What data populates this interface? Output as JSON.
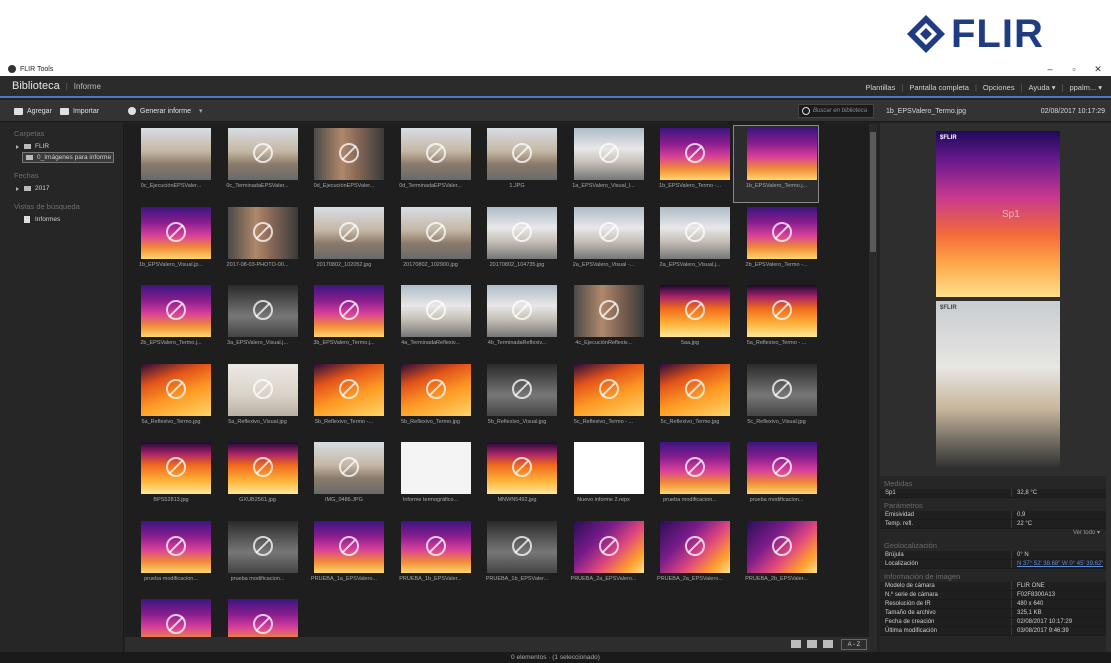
{
  "brand": {
    "wordmark": "FLIR",
    "color": "#1f3b82"
  },
  "window": {
    "title": "FLIR Tools"
  },
  "menubar": {
    "library": "Biblioteca",
    "crumb": "Informe",
    "right": [
      "Plantillas",
      "Pantalla completa",
      "Opciones",
      "Ayuda ▾",
      "ppalm... ▾"
    ]
  },
  "toolbar": {
    "add": "Agregar",
    "import": "Importar",
    "report": "Generar informe",
    "search_placeholder": "Buscar en biblioteca",
    "selected_file": "1b_EPSValero_Termo.jpg",
    "selected_date": "02/08/2017 10:17:29"
  },
  "sidebar": {
    "folders_title": "Carpetas",
    "folder_root": "FLIR",
    "folder_selected": "0_Imágenes para informe",
    "dates_title": "Fechas",
    "date_item": "2017",
    "searches_title": "Vistas de búsqueda",
    "search_item": "Informes"
  },
  "thumbnails": [
    "0c_EjecuciónEPSValer...",
    "0c_TerminadaEPSValer...",
    "0d_EjecuciónEPSValer...",
    "0d_TerminadaEPSValer...",
    "1.JPG",
    "1a_EPSValero_Visual_l...",
    "1b_EPSValero_Termo -...",
    "1b_EPSValero_Termo.j...",
    "1b_EPSValero_Visual.jp...",
    "2017-08-03-PHOTO-00...",
    "20170802_102052.jpg",
    "20170802_102900.jpg",
    "20170802_104735.jpg",
    "2a_EPSValero_Visual -...",
    "2a_EPSValero_Visual.j...",
    "2b_EPSValero_Termo -...",
    "2b_EPSValero_Termo.j...",
    "3a_EPSValero_Visual.j...",
    "3b_EPSValero_Termo.j...",
    "4a_TerminadaReflexiv...",
    "4b_TerminadaReflexiv...",
    "4c_EjecuciónReflexiv...",
    "5aa.jpg",
    "5a_Reflexivo_Termo - ...",
    "5a_Reflexivo_Termo.jpg",
    "5a_Reflexivo_Visual.jpg",
    "5b_Reflexivo_Termo -...",
    "5b_Reflexivo_Termo.jpg",
    "5b_Reflexivo_Visual.jpg",
    "5c_Reflexivo_Termo - ...",
    "5c_Reflexivo_Termo.jpg",
    "5c_Reflexivo_Visual.jpg",
    "BPS52813.jpg",
    "GXUB2561.jpg",
    "IMG_0486.JPG",
    "Informe termográfico...",
    "MNWN5492.jpg",
    "Nuevo informe 2.repx",
    "prueba modificacion...",
    "prueba modificacion...",
    "prueba modificacion...",
    "prueba modificacion...",
    "PRUEBA_1a_EPSValero...",
    "PRUEBA_1b_EPSValer...",
    "PRUEBA_1b_EPSValer...",
    "PRUEBA_2a_EPSValero...",
    "PRUEBA_2a_EPSValero...",
    "PRUEBA_2b_EPSValer...",
    "",
    ""
  ],
  "preview": {
    "ir_mark": "$FLIR",
    "vis_mark": "$FLIR",
    "spot_label": "Sp1"
  },
  "properties": {
    "measurements_title": "Medidas",
    "measurements": [
      {
        "k": "Sp1",
        "v": "32,8 °C"
      }
    ],
    "params_title": "Parámetros",
    "params": [
      {
        "k": "Emisividad",
        "v": "0,9"
      },
      {
        "k": "Temp. refl.",
        "v": "22 °C"
      }
    ],
    "more": "Ver todo ▾",
    "geo_title": "Geolocalización",
    "geo": [
      {
        "k": "Brújula",
        "v": "0° N"
      },
      {
        "k": "Localización",
        "v": "N 37° 52' 38.68\" W 0° 45' 39.62\""
      }
    ],
    "info_title": "Información de imagen",
    "info": [
      {
        "k": "Modelo de cámara",
        "v": "FLIR ONE"
      },
      {
        "k": "N.º serie de cámara",
        "v": "F02F8300A13"
      },
      {
        "k": "Resolución de IR",
        "v": "480 x 640"
      },
      {
        "k": "Tamaño de archivo",
        "v": "325,1 KB"
      },
      {
        "k": "Fecha de creación",
        "v": "02/08/2017 10:17:29"
      },
      {
        "k": "Última modificación",
        "v": "03/08/2017 9:46:39"
      }
    ]
  },
  "footer": {
    "sort": "A - Z",
    "status": "0 elementos · (1 seleccionado)"
  }
}
